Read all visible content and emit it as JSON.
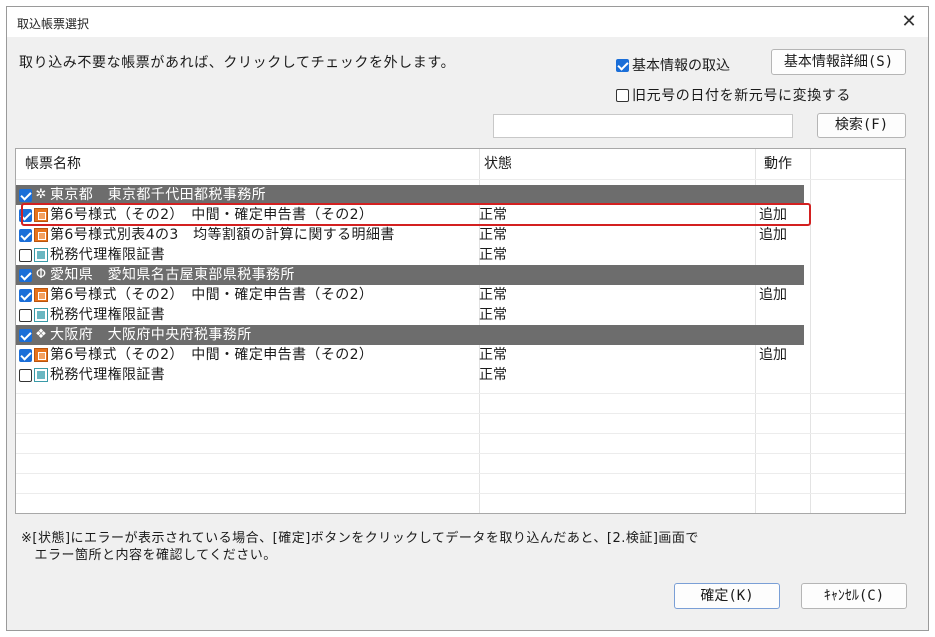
{
  "window": {
    "title": "取込帳票選択",
    "close_glyph": "✕"
  },
  "instruction": "取り込み不要な帳票があれば、クリックしてチェックを外します。",
  "options": {
    "basic_info": {
      "label": "基本情報の取込",
      "checked": true
    },
    "convert_era": {
      "label": "旧元号の日付を新元号に変換する",
      "checked": false
    }
  },
  "buttons": {
    "basic_detail": "基本情報詳細(S)",
    "search": "検索(F)",
    "ok": "確定(K)",
    "cancel": "ｷｬﾝｾﾙ(C)"
  },
  "search": {
    "value": ""
  },
  "table": {
    "columns": [
      "帳票名称",
      "状態",
      "動作"
    ],
    "rows": [
      {
        "type": "group",
        "checked": true,
        "icon": "tokyo-emblem-icon",
        "emblem": "✲",
        "name": "東京都　東京都千代田都税事務所",
        "status": "",
        "action": ""
      },
      {
        "type": "form",
        "checked": true,
        "icon": "form-document-icon",
        "name": "第6号様式（その2）　中間・確定申告書（その2）",
        "status": "正常",
        "action": "追加",
        "highlighted": true
      },
      {
        "type": "form",
        "checked": true,
        "icon": "form-document-icon",
        "name": "第6号様式別表4の3　均等割額の計算に関する明細書",
        "status": "正常",
        "action": "追加"
      },
      {
        "type": "form",
        "checked": false,
        "icon": "certificate-document-icon",
        "name": "税務代理権限証書",
        "status": "正常",
        "action": ""
      },
      {
        "type": "group",
        "checked": true,
        "icon": "aichi-emblem-icon",
        "emblem": "Φ",
        "name": "愛知県　愛知県名古屋東部県税事務所",
        "status": "",
        "action": ""
      },
      {
        "type": "form",
        "checked": true,
        "icon": "form-document-icon",
        "name": "第6号様式（その2）　中間・確定申告書（その2）",
        "status": "正常",
        "action": "追加"
      },
      {
        "type": "form",
        "checked": false,
        "icon": "certificate-document-icon",
        "name": "税務代理権限証書",
        "status": "正常",
        "action": ""
      },
      {
        "type": "group",
        "checked": true,
        "icon": "osaka-emblem-icon",
        "emblem": "❖",
        "name": "大阪府　大阪府中央府税事務所",
        "status": "",
        "action": ""
      },
      {
        "type": "form",
        "checked": true,
        "icon": "form-document-icon",
        "name": "第6号様式（その2）　中間・確定申告書（その2）",
        "status": "正常",
        "action": "追加"
      },
      {
        "type": "form",
        "checked": false,
        "icon": "certificate-document-icon",
        "name": "税務代理権限証書",
        "status": "正常",
        "action": ""
      }
    ]
  },
  "note": {
    "line1": "※[状態]にエラーが表示されている場合、[確定]ボタンをクリックしてデータを取り込んだあと、[2.検証]画面で",
    "line2": "　エラー箇所と内容を確認してください。"
  },
  "colors": {
    "group_row_bg": "#6d6d6d",
    "highlight": "#d32020",
    "checkbox_on": "#1a6ed8"
  }
}
